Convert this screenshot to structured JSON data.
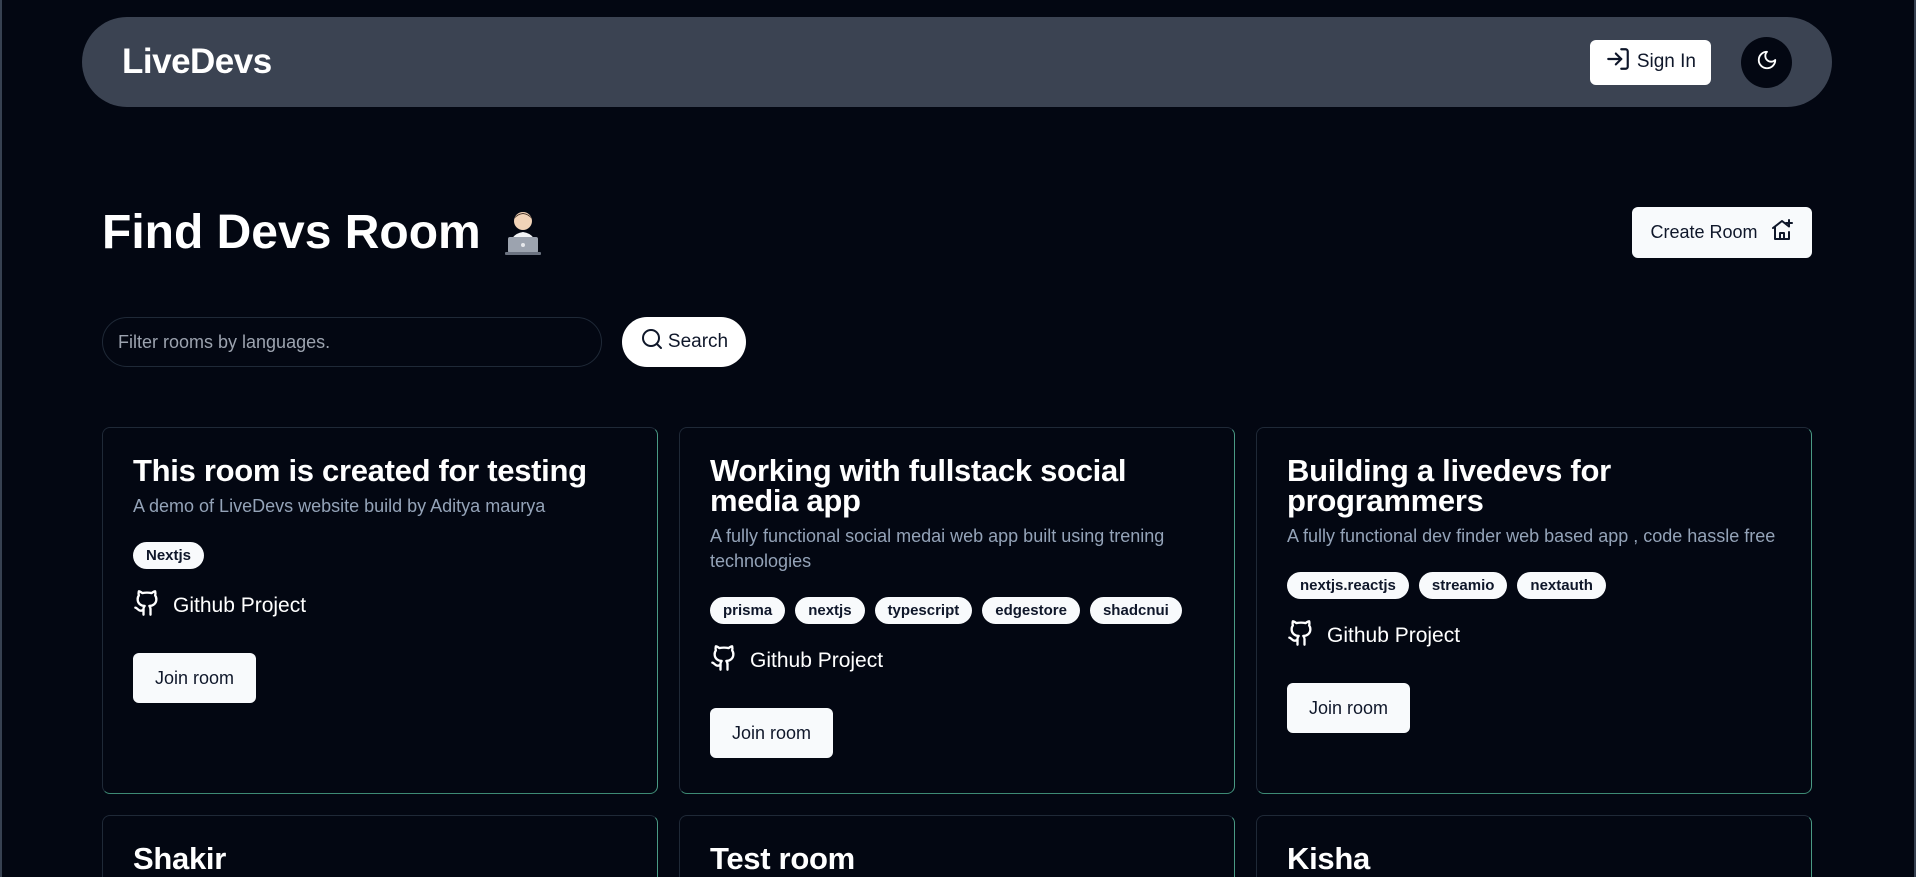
{
  "header": {
    "logo": "LiveDevs",
    "signin_label": "Sign In"
  },
  "page": {
    "title": "Find Devs Room",
    "create_label": "Create Room"
  },
  "search": {
    "placeholder": "Filter rooms by languages.",
    "button_label": "Search"
  },
  "rooms": [
    {
      "title": "This room is created for testing",
      "description": "A demo of LiveDevs website build by Aditya maurya",
      "tags": [
        "Nextjs"
      ],
      "github_label": "Github Project",
      "join_label": "Join room"
    },
    {
      "title": "Working with fullstack social media app",
      "description": "A fully functional social medai web app built using trening technologies",
      "tags": [
        "prisma",
        "nextjs",
        "typescript",
        "edgestore",
        "shadcnui"
      ],
      "github_label": "Github Project",
      "join_label": "Join room"
    },
    {
      "title": "Building a livedevs for programmers",
      "description": "A fully functional dev finder web based app , code hassle free",
      "tags": [
        "nextjs.reactjs",
        "streamio",
        "nextauth"
      ],
      "github_label": "Github Project",
      "join_label": "Join room"
    },
    {
      "title": "Shakir"
    },
    {
      "title": "Test room"
    },
    {
      "title": "Kisha"
    }
  ],
  "colors": {
    "background": "#030712",
    "header_bg": "#3b4352",
    "card_accent_border": "#4a9a84",
    "muted_text": "#94a3b8"
  },
  "icons": [
    "sign-in-icon",
    "moon-icon",
    "technologist-emoji",
    "house-plus-icon",
    "search-icon",
    "github-icon"
  ]
}
